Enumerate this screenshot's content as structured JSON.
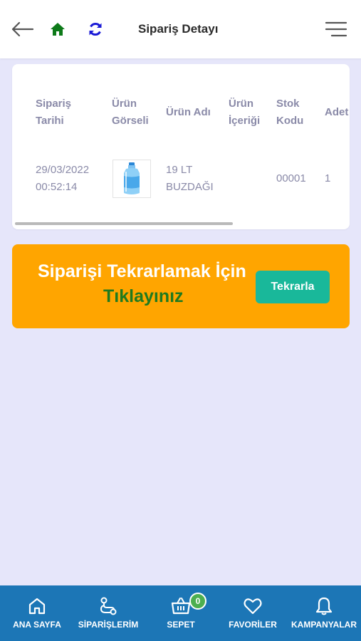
{
  "header": {
    "title": "Sipariş Detayı",
    "icons": [
      "back-arrow-icon",
      "home-icon",
      "refresh-icon",
      "menu-icon"
    ]
  },
  "order_table": {
    "columns": [
      "Sipariş\nTarihi",
      "Ürün\nGörseli",
      "Ürün Adı",
      "Ürün\nİçeriği",
      "Stok\nKodu",
      "Adet"
    ],
    "rows": [
      {
        "date": "29/03/2022\n00:52:14",
        "image_icon": "water-bottle-icon",
        "name": "19 LT\nBUZDAĞI",
        "content": "",
        "stock_code": "00001",
        "quantity": "1"
      }
    ]
  },
  "promo": {
    "line1": "Siparişi Tekrarlamak İçin",
    "line2": "Tıklayınız",
    "button_label": "Tekrarla",
    "background_color": "#ffa500",
    "button_color": "#19b89a"
  },
  "bottom_nav": {
    "items": [
      {
        "label": "ANA SAYFA",
        "icon": "home-outline-icon"
      },
      {
        "label": "SİPARİŞLERİM",
        "icon": "route-icon"
      },
      {
        "label": "SEPET",
        "icon": "basket-icon",
        "badge": "0"
      },
      {
        "label": "FAVORİLER",
        "icon": "heart-icon"
      },
      {
        "label": "KAMPANYALAR",
        "icon": "bell-icon"
      }
    ],
    "background_color": "#1c76b6"
  }
}
